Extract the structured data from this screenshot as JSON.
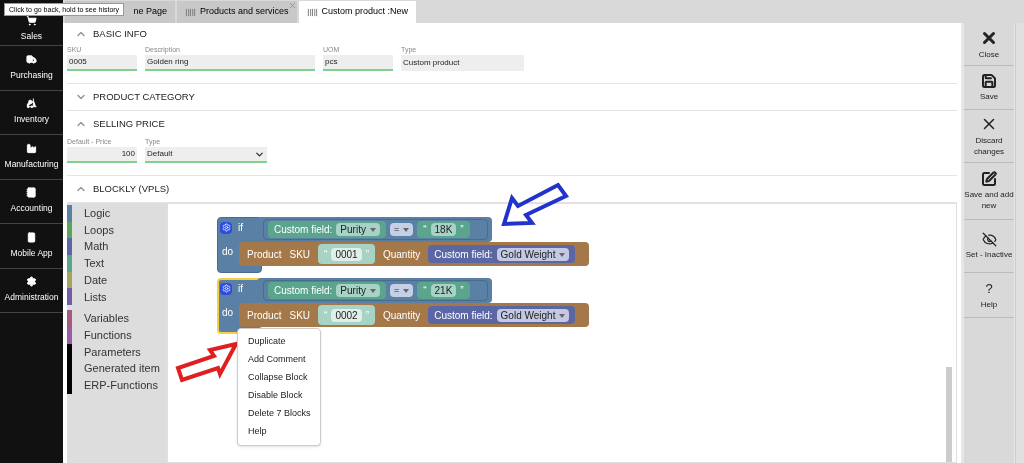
{
  "tooltip": "Click to go back, hold to see history",
  "sidebar": [
    {
      "label": "Sales"
    },
    {
      "label": "Purchasing"
    },
    {
      "label": "Inventory"
    },
    {
      "label": "Manufacturing"
    },
    {
      "label": "Accounting"
    },
    {
      "label": "Mobile App"
    },
    {
      "label": "Administration"
    }
  ],
  "tabs": [
    {
      "label": "ne Page",
      "selected": false
    },
    {
      "label": "Products and services",
      "selected": false
    },
    {
      "label": "Custom product :New",
      "selected": true
    }
  ],
  "sections": [
    {
      "title": "BASIC INFO",
      "expanded": true,
      "fields": [
        {
          "label": "SKU",
          "value": "0005",
          "kind": "text",
          "editable": true
        },
        {
          "label": "Description",
          "value": "Golden ring",
          "kind": "text",
          "editable": true
        },
        {
          "label": "UOM",
          "value": "pcs",
          "kind": "text",
          "editable": true
        },
        {
          "label": "Type",
          "value": "Custom product",
          "kind": "text",
          "editable": false
        }
      ]
    },
    {
      "title": "PRODUCT CATEGORY",
      "expanded": false
    },
    {
      "title": "SELLING PRICE",
      "expanded": true,
      "fields": [
        {
          "label": "Default - Price",
          "value": "100",
          "kind": "number",
          "editable": true
        },
        {
          "label": "Type",
          "value": "Default",
          "kind": "select",
          "editable": true
        }
      ]
    },
    {
      "title": "BLOCKLY (VPLS)",
      "expanded": true
    }
  ],
  "toolbox": [
    {
      "label": "Logic",
      "color": "#5b80a5"
    },
    {
      "label": "Loops",
      "color": "#5ba55b"
    },
    {
      "label": "Math",
      "color": "#5b67a5"
    },
    {
      "label": "Text",
      "color": "#5ba58c"
    },
    {
      "label": "Date",
      "color": "#a5a55b"
    },
    {
      "label": "Lists",
      "color": "#745ba5"
    },
    {
      "label": "Variables",
      "color": "#a55b80"
    },
    {
      "label": "Functions",
      "color": "#995ba5"
    },
    {
      "label": "Parameters",
      "color": "#000000"
    },
    {
      "label": "Generated item",
      "color": "#000000"
    },
    {
      "label": "ERP-Functions",
      "color": "#000000"
    }
  ],
  "blocks": [
    {
      "if": "if",
      "do": "do",
      "selected": false,
      "condition": {
        "field_label": "Custom field:",
        "field": "Purity",
        "operator": "=",
        "open_quote": "“",
        "value": "18K",
        "close_quote": "”"
      },
      "action": {
        "label": "Product",
        "sku_label": "SKU",
        "open_quote": "“",
        "sku": "0001",
        "close_quote": "”",
        "qty_label": "Quantity",
        "qty_field_label": "Custom field:",
        "qty_field": "Gold Weight"
      }
    },
    {
      "if": "if",
      "do": "do",
      "selected": true,
      "condition": {
        "field_label": "Custom field:",
        "field": "Purity",
        "operator": "=",
        "open_quote": "“",
        "value": "21K",
        "close_quote": "”"
      },
      "action": {
        "label": "Product",
        "sku_label": "SKU",
        "open_quote": "“",
        "sku": "0002",
        "close_quote": "”",
        "qty_label": "Quantity",
        "qty_field_label": "Custom field:",
        "qty_field": "Gold Weight"
      }
    }
  ],
  "context_menu": [
    "Duplicate",
    "Add Comment",
    "Collapse Block",
    "Disable Block",
    "Delete 7 Blocks",
    "Help"
  ],
  "actions": [
    {
      "label": "Close"
    },
    {
      "label": "Save"
    },
    {
      "label": "Discard changes"
    },
    {
      "label": "Save and add new"
    },
    {
      "label": "Set - Inactive"
    },
    {
      "label": "Help",
      "glyph": "?"
    }
  ]
}
